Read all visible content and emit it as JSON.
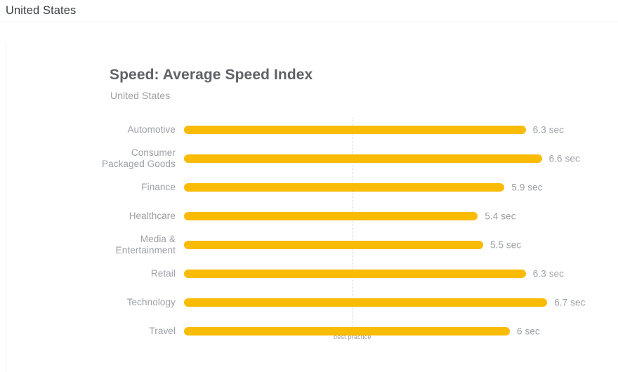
{
  "header": {
    "title": "United States"
  },
  "chart_panel": {
    "title": "Speed: Average Speed Index",
    "subtitle": "United States"
  },
  "benchmark": {
    "label": "best practice",
    "value_sec": 3.05
  },
  "colors": {
    "bar": "#fabb05",
    "label_text": "#9aa0a6",
    "title_text": "#5f6368",
    "header_text": "#3c4043",
    "benchmark_line": "#c9ccd1"
  },
  "chart_data": {
    "type": "bar",
    "orientation": "horizontal",
    "title": "Speed: Average Speed Index",
    "subtitle": "United States",
    "xlabel": "",
    "ylabel": "",
    "unit": "sec",
    "xlim": [
      0,
      7.3
    ],
    "grid": false,
    "legend": "none",
    "annotations": [
      {
        "name": "best practice",
        "type": "vline",
        "x": 3.05,
        "label": "best practice"
      }
    ],
    "categories": [
      "Automotive",
      "Consumer\nPackaged Goods",
      "Finance",
      "Healthcare",
      "Media &\nEntertainment",
      "Retail",
      "Technology",
      "Travel"
    ],
    "values": [
      6.3,
      6.6,
      5.9,
      5.4,
      5.5,
      6.3,
      6.7,
      6.0
    ],
    "value_labels": [
      "6.3 sec",
      "6.6 sec",
      "5.9 sec",
      "5.4 sec",
      "5.5 sec",
      "6.3 sec",
      "6.7 sec",
      "6 sec"
    ]
  }
}
